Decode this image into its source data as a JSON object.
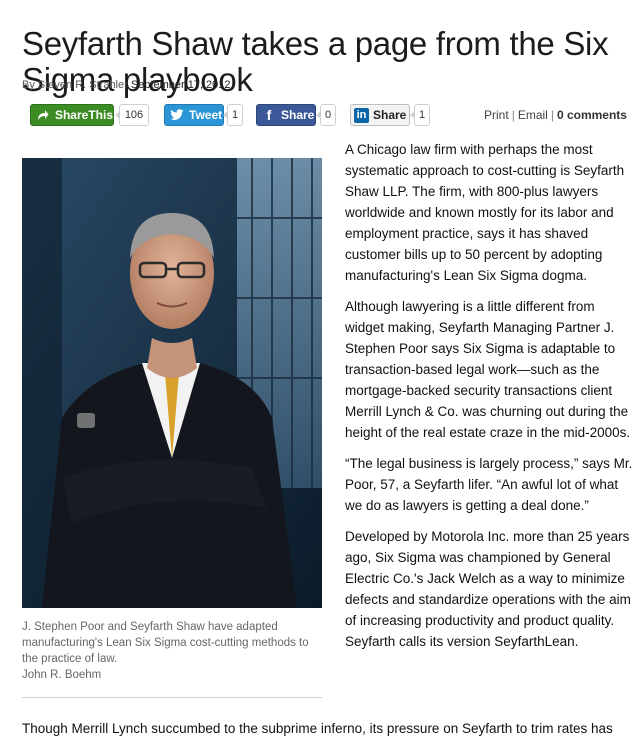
{
  "article": {
    "title": "Seyfarth Shaw takes a page from the Six Sigma playbook",
    "byline_prefix": "By",
    "author": "Steven R. Strahler",
    "date": "September 17, 2012"
  },
  "share": {
    "sharethis_label": "ShareThis",
    "sharethis_count": "106",
    "tweet_label": "Tweet",
    "tweet_count": "1",
    "facebook_label": "Share",
    "facebook_count": "0",
    "linkedin_label": "Share",
    "linkedin_count": "1",
    "print_label": "Print",
    "email_label": "Email",
    "comments_label": "0 comments",
    "separator": "|"
  },
  "photo": {
    "caption": "J. Stephen Poor and Seyfarth Shaw have adapted manufacturing's Lean Six Sigma cost-cutting methods to the practice of law.",
    "credit": "John R. Boehm"
  },
  "body": {
    "p1": "A Chicago law firm with perhaps the most systematic approach to cost-cutting is Seyfarth Shaw LLP. The firm, with 800-plus lawyers worldwide and known mostly for its labor and employment practice, says it has shaved customer bills up to 50 percent by adopting manufacturing's Lean Six Sigma dogma.",
    "p2": "Although lawyering is a little different from widget making, Seyfarth Managing Partner J. Stephen Poor says Six Sigma is adaptable to transaction-based legal work—such as the mortgage-backed security transactions client Merrill Lynch & Co. was churning out during the height of the real estate craze in the mid-2000s.",
    "p3": "“The legal business is largely process,” says Mr. Poor, 57, a Seyfarth lifer. “An awful lot of what we do as lawyers is getting a deal done.”",
    "p4": "Developed by Motorola Inc. more than 25 years ago, Six Sigma was championed by General Electric Co.'s Jack Welch as a way to minimize defects and standardize operations with the aim of increasing productivity and product quality. Seyfarth calls its version SeyfarthLean.",
    "p5": "Though Merrill Lynch succumbed to the subprime inferno, its pressure on Seyfarth to trim rates has"
  },
  "colors": {
    "sharethis_green": "#3b8c24",
    "twitter_blue": "#2b95d6",
    "facebook_blue": "#3b5998",
    "linkedin_blue": "#0b66a8"
  }
}
